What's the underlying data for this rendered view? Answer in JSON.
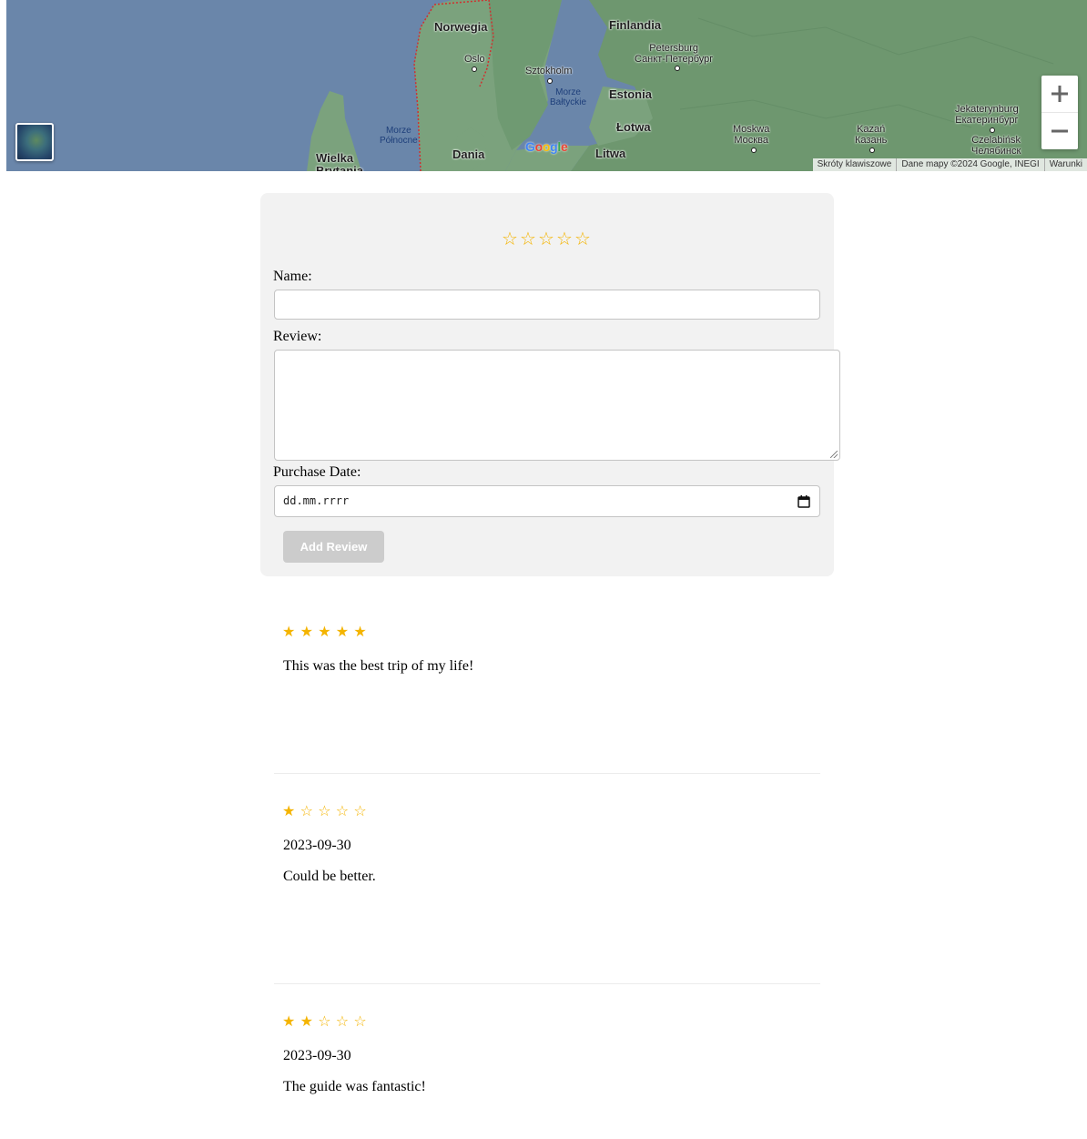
{
  "map": {
    "countries": [
      {
        "key": "norway",
        "label": "Norwegia"
      },
      {
        "key": "finland",
        "label": "Finlandia"
      },
      {
        "key": "estonia",
        "label": "Estonia"
      },
      {
        "key": "latvia",
        "label": "Łotwa"
      },
      {
        "key": "lithuania",
        "label": "Litwa"
      },
      {
        "key": "denmark",
        "label": "Dania"
      },
      {
        "key": "britain",
        "label": "Wielka Brytania"
      }
    ],
    "cities": [
      {
        "key": "oslo",
        "label": "Oslo"
      },
      {
        "key": "stockholm",
        "label": "Sztokholm"
      },
      {
        "key": "petersburg",
        "label": "Petersburg\nСанкт-Петербург"
      },
      {
        "key": "moscow",
        "label": "Moskwa\nМосква"
      },
      {
        "key": "kazan",
        "label": "Kazań\nКазань"
      },
      {
        "key": "yekaterinburg",
        "label": "Jekaterynburg\nЕкатеринбург"
      },
      {
        "key": "chelyabinsk",
        "label": "Czelabińsk\nЧелябинск"
      }
    ],
    "seas": [
      {
        "key": "north_sea",
        "label": "Morze\nPółnocne"
      },
      {
        "key": "baltic_sea",
        "label": "Morze\nBałtyckie"
      }
    ],
    "logo": "Google",
    "zoom_in": "+",
    "zoom_out": "−",
    "attribution": [
      "Skróty klawiszowe",
      "Dane mapy ©2024 Google, INEGI",
      "Warunki"
    ]
  },
  "form": {
    "rating_stars": [
      "☆",
      "☆",
      "☆",
      "☆",
      "☆"
    ],
    "name_label": "Name:",
    "name_value": "",
    "review_label": "Review:",
    "review_value": "",
    "date_label": "Purchase Date:",
    "date_placeholder": "dd.mm.rrrr",
    "submit_label": "Add Review"
  },
  "reviews": [
    {
      "rating": 5,
      "stars": [
        "★",
        "★",
        "★",
        "★",
        "★"
      ],
      "date": "",
      "text": "This was the best trip of my life!"
    },
    {
      "rating": 1,
      "stars": [
        "★",
        "☆",
        "☆",
        "☆",
        "☆"
      ],
      "date": "2023-09-30",
      "text": "Could be better."
    },
    {
      "rating": 2,
      "stars": [
        "★",
        "★",
        "☆",
        "☆",
        "☆"
      ],
      "date": "2023-09-30",
      "text": "The guide was fantastic!"
    }
  ],
  "colors": {
    "star": "#f4b400",
    "card_bg": "#f2f2f2",
    "button_disabled": "#cccccc",
    "water": "#6a86aa",
    "land": "#7aa07a"
  }
}
